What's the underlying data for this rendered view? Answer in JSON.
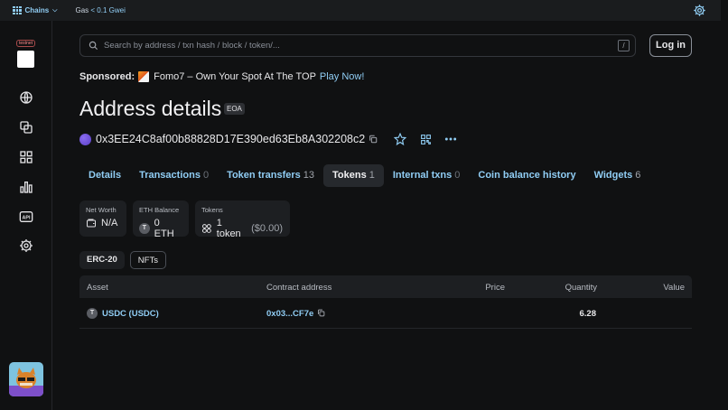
{
  "topbar": {
    "chains_label": "Chains",
    "gas_label": "Gas",
    "gas_value": "< 0.1 Gwei"
  },
  "sidebar": {
    "testnet_badge": "testnet",
    "items": [
      {
        "icon": "globe-icon"
      },
      {
        "icon": "tokens-icon"
      },
      {
        "icon": "apps-grid-icon"
      },
      {
        "icon": "stats-chart-icon"
      },
      {
        "icon": "api-icon",
        "label": "API"
      },
      {
        "icon": "gear-icon"
      }
    ]
  },
  "search": {
    "placeholder": "Search by address / txn hash / block / token/...",
    "shortcut": "/"
  },
  "auth": {
    "login_label": "Log in"
  },
  "sponsored": {
    "label": "Sponsored:",
    "text": "Fomo7 – Own Your Spot At The TOP",
    "cta": "Play Now!"
  },
  "page": {
    "title": "Address details",
    "badge": "EOA",
    "address": "0x3EE24C8af00b88828D17E390ed63Eb8A302208c2"
  },
  "tabs": [
    {
      "label": "Details",
      "count": ""
    },
    {
      "label": "Transactions",
      "count": "0"
    },
    {
      "label": "Token transfers",
      "count": "13"
    },
    {
      "label": "Tokens",
      "count": "1",
      "active": true
    },
    {
      "label": "Internal txns",
      "count": "0"
    },
    {
      "label": "Coin balance history",
      "count": ""
    },
    {
      "label": "Widgets",
      "count": "6"
    }
  ],
  "cards": {
    "net_worth": {
      "label": "Net Worth",
      "value": "N/A"
    },
    "eth_balance": {
      "label": "ETH Balance",
      "symbol_letter": "T",
      "value": "0 ETH"
    },
    "tokens": {
      "label": "Tokens",
      "value": "1 token",
      "sub": "($0.00)"
    }
  },
  "filters": [
    "ERC-20",
    "NFTs"
  ],
  "table": {
    "headers": [
      "Asset",
      "Contract address",
      "Price",
      "Quantity",
      "Value"
    ],
    "rows": [
      {
        "asset_letter": "T",
        "asset": "USDC (USDC)",
        "contract": "0x03...CF7e",
        "price": "",
        "quantity": "6.28",
        "value": ""
      }
    ]
  },
  "colors": {
    "accent": "#90cdf4",
    "background": "#101112",
    "card": "#1d1f22"
  }
}
